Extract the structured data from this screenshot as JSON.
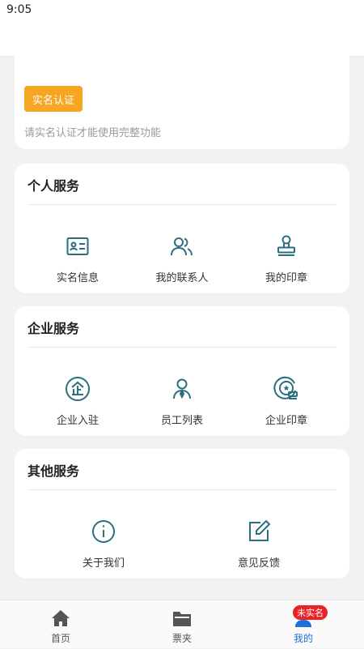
{
  "status_bar": {
    "time": "9:05"
  },
  "verify_card": {
    "button_label": "实名认证",
    "hint": "请实名认证才能使用完整功能"
  },
  "sections": {
    "personal": {
      "title": "个人服务",
      "items": [
        {
          "label": "实名信息",
          "icon": "id-card-icon"
        },
        {
          "label": "我的联系人",
          "icon": "contacts-icon"
        },
        {
          "label": "我的印章",
          "icon": "stamp-icon"
        }
      ]
    },
    "enterprise": {
      "title": "企业服务",
      "items": [
        {
          "label": "企业入驻",
          "icon": "enterprise-icon"
        },
        {
          "label": "员工列表",
          "icon": "employee-icon"
        },
        {
          "label": "企业印章",
          "icon": "enterprise-seal-icon"
        }
      ]
    },
    "other": {
      "title": "其他服务",
      "items": [
        {
          "label": "关于我们",
          "icon": "info-icon"
        },
        {
          "label": "意见反馈",
          "icon": "feedback-icon"
        }
      ]
    }
  },
  "tab_bar": {
    "tabs": [
      {
        "label": "首页",
        "icon": "home-icon"
      },
      {
        "label": "票夹",
        "icon": "folder-icon"
      },
      {
        "label": "我的",
        "icon": "user-icon",
        "active": true
      }
    ],
    "badge": "未实名"
  },
  "colors": {
    "icon_teal": "#2a6f80",
    "verify_orange": "#f5a623",
    "active_blue": "#1e6fd9",
    "badge_red": "#e8242a"
  }
}
